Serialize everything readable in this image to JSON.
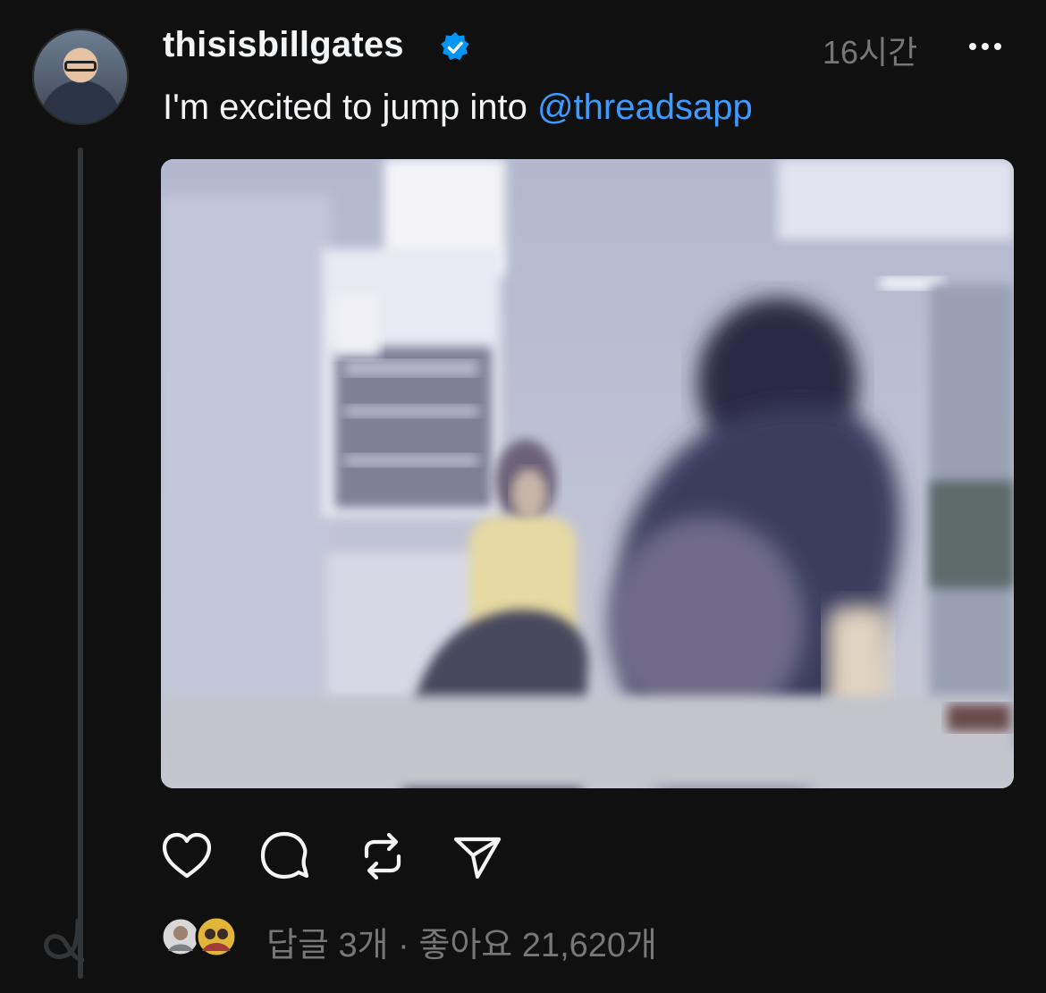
{
  "post": {
    "username": "thisisbillgates",
    "timestamp": "16시간",
    "text_prefix": "I'm excited to jump into ",
    "mention": "@threadsapp"
  },
  "stats": {
    "replies": "답글 3개",
    "separator": " · ",
    "likes": "좋아요 21,620개"
  },
  "icons": {
    "verified": "verified-badge-icon",
    "more": "more-options-icon",
    "like": "heart-icon",
    "reply": "comment-icon",
    "repost": "repost-icon",
    "share": "send-icon"
  },
  "colors": {
    "background": "#101010",
    "mention": "#3d9bff",
    "verified": "#0095f6",
    "muted": "#777777"
  }
}
